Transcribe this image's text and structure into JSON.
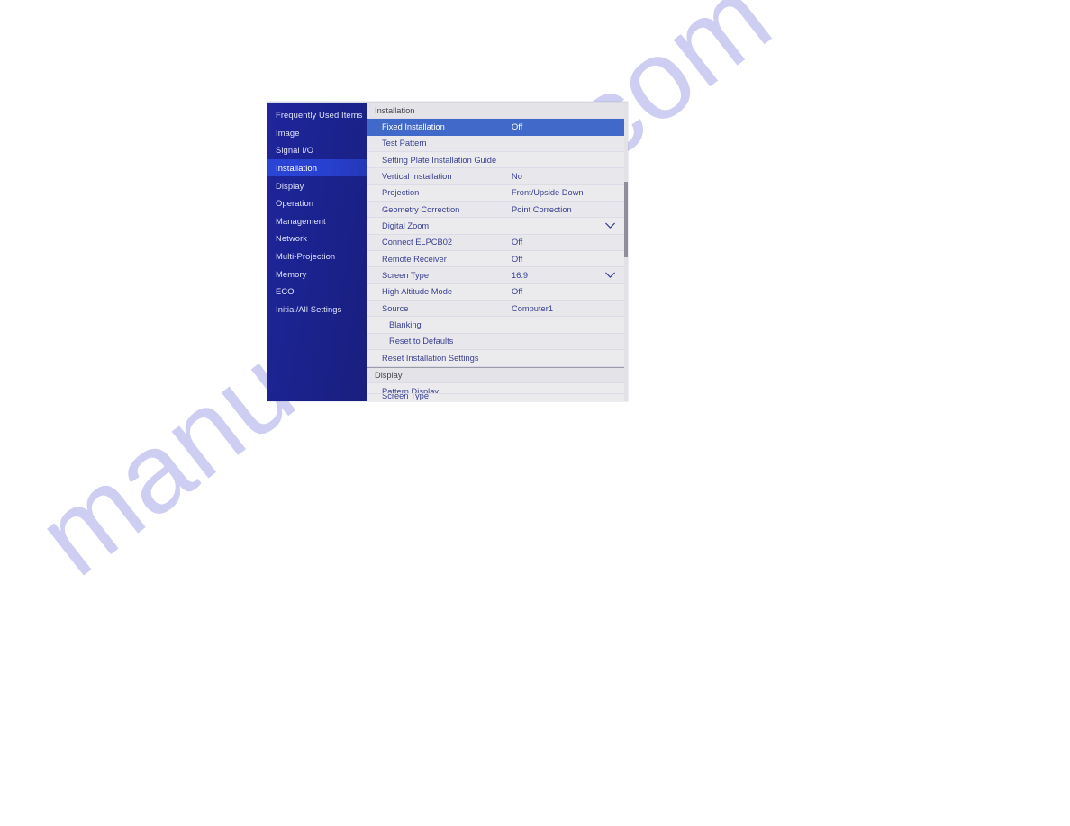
{
  "watermark": {
    "text": "manualshive.com"
  },
  "osd": {
    "sidebar": {
      "items": [
        {
          "label": "Frequently Used Items",
          "selected": false
        },
        {
          "label": "Image",
          "selected": false
        },
        {
          "label": "Signal I/O",
          "selected": false
        },
        {
          "label": "Installation",
          "selected": true
        },
        {
          "label": "Display",
          "selected": false
        },
        {
          "label": "Operation",
          "selected": false
        },
        {
          "label": "Management",
          "selected": false
        },
        {
          "label": "Network",
          "selected": false
        },
        {
          "label": "Multi-Projection",
          "selected": false
        },
        {
          "label": "Memory",
          "selected": false
        },
        {
          "label": "ECO",
          "selected": false
        },
        {
          "label": "Initial/All Settings",
          "selected": false
        }
      ]
    },
    "content": {
      "rows": [
        {
          "kind": "section",
          "label": "Installation",
          "value": "",
          "icon": "",
          "indent": 0,
          "selected": false,
          "divider": false
        },
        {
          "kind": "item",
          "label": "Fixed Installation",
          "value": "Off",
          "icon": "",
          "indent": 1,
          "selected": true,
          "divider": false
        },
        {
          "kind": "item",
          "label": "Test Pattern",
          "value": "",
          "icon": "",
          "indent": 1,
          "selected": false,
          "divider": false
        },
        {
          "kind": "item",
          "label": "Setting Plate Installation Guide",
          "value": "",
          "icon": "",
          "indent": 1,
          "selected": false,
          "divider": false
        },
        {
          "kind": "item",
          "label": "Vertical Installation",
          "value": "No",
          "icon": "",
          "indent": 1,
          "selected": false,
          "divider": false
        },
        {
          "kind": "item",
          "label": "Projection",
          "value": "Front/Upside Down",
          "icon": "",
          "indent": 1,
          "selected": false,
          "divider": false
        },
        {
          "kind": "item",
          "label": "Geometry Correction",
          "value": "Point Correction",
          "icon": "",
          "indent": 1,
          "selected": false,
          "divider": false
        },
        {
          "kind": "item",
          "label": "Digital Zoom",
          "value": "",
          "icon": "chevron-down-icon",
          "indent": 1,
          "selected": false,
          "divider": false
        },
        {
          "kind": "item",
          "label": "Connect ELPCB02",
          "value": "Off",
          "icon": "",
          "indent": 1,
          "selected": false,
          "divider": false
        },
        {
          "kind": "item",
          "label": "Remote Receiver",
          "value": "Off",
          "icon": "",
          "indent": 1,
          "selected": false,
          "divider": false
        },
        {
          "kind": "item",
          "label": "Screen Type",
          "value": "16:9",
          "icon": "chevron-down-icon",
          "indent": 1,
          "selected": false,
          "divider": false
        },
        {
          "kind": "item",
          "label": "High Altitude Mode",
          "value": "Off",
          "icon": "",
          "indent": 1,
          "selected": false,
          "divider": false
        },
        {
          "kind": "item",
          "label": "Source",
          "value": "Computer1",
          "icon": "",
          "indent": 1,
          "selected": false,
          "divider": false
        },
        {
          "kind": "item",
          "label": "Blanking",
          "value": "",
          "icon": "",
          "indent": 2,
          "selected": false,
          "divider": false
        },
        {
          "kind": "item",
          "label": "Reset to Defaults",
          "value": "",
          "icon": "",
          "indent": 2,
          "selected": false,
          "divider": false
        },
        {
          "kind": "item",
          "label": "Reset Installation Settings",
          "value": "",
          "icon": "",
          "indent": 1,
          "selected": false,
          "divider": false
        },
        {
          "kind": "section",
          "label": "Display",
          "value": "",
          "icon": "",
          "indent": 0,
          "selected": false,
          "divider": true
        },
        {
          "kind": "item",
          "label": "Pattern Display",
          "value": "",
          "icon": "",
          "indent": 1,
          "selected": false,
          "divider": false
        }
      ],
      "clipped_row_label": "Screen Type"
    },
    "scrollbar": {
      "present": true
    }
  },
  "colors": {
    "sidebar_bg": "#1b2390",
    "sidebar_selected": "#2840cf",
    "row_selected": "#4169ca",
    "row_text": "#3b4091",
    "section_text": "#45454f",
    "watermark": "#ccccf2"
  }
}
